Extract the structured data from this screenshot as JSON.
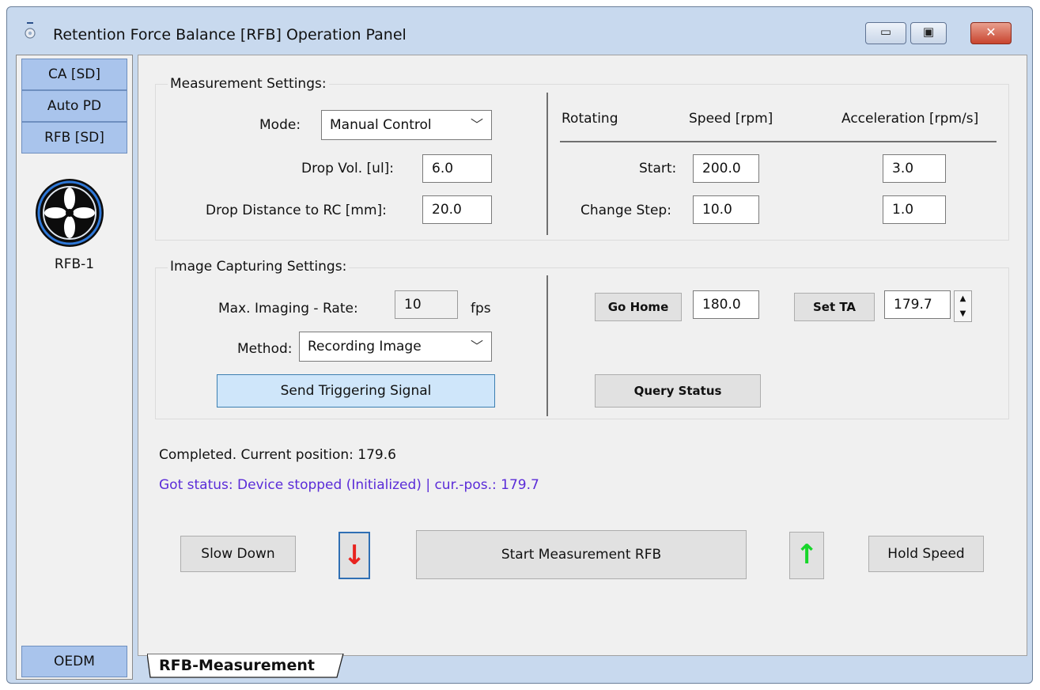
{
  "window": {
    "title": "Retention Force Balance [RFB] Operation Panel",
    "controls": {
      "minimize": "▭",
      "maximize": "▣",
      "close": "✕"
    }
  },
  "sidebar": {
    "items": [
      {
        "label": "CA [SD]"
      },
      {
        "label": "Auto PD"
      },
      {
        "label": "RFB [SD]"
      }
    ],
    "device_name": "RFB-1",
    "bottom_item": "OEDM"
  },
  "measurement_settings": {
    "title": "Measurement Settings:",
    "mode_label": "Mode:",
    "mode_value": "Manual Control",
    "drop_vol_label": "Drop Vol. [ul]:",
    "drop_vol_value": "6.0",
    "drop_distance_label": "Drop Distance to RC [mm]:",
    "drop_distance_value": "20.0"
  },
  "rotating": {
    "header_rotating": "Rotating",
    "header_speed": "Speed [rpm]",
    "header_accel": "Acceleration [rpm/s]",
    "start_label": "Start:",
    "start_speed": "200.0",
    "start_accel": "3.0",
    "step_label": "Change Step:",
    "step_speed": "10.0",
    "step_accel": "1.0"
  },
  "image_capturing": {
    "title": "Image Capturing Settings:",
    "rate_label": "Max. Imaging - Rate:",
    "rate_value": "10",
    "rate_unit": "fps",
    "method_label": "Method:",
    "method_value": "Recording Image",
    "trigger_button": "Send Triggering Signal"
  },
  "positioning": {
    "go_home_button": "Go Home",
    "go_home_value": "180.0",
    "set_ta_button": "Set TA",
    "set_ta_value": "179.7",
    "query_status_button": "Query Status"
  },
  "status": {
    "line1": "Completed. Current position: 179.6",
    "line2": "Got status: Device stopped (Initialized) | cur.-pos.: 179.7"
  },
  "controls": {
    "slow_down": "Slow Down",
    "down_arrow": "↓",
    "start_measurement": "Start Measurement  RFB",
    "up_arrow": "↑",
    "hold_speed": "Hold Speed"
  },
  "tab": {
    "label": "RFB-Measurement"
  },
  "colors": {
    "sidebar_button": "#a9c4ec",
    "status_blue": "#5a2bd8",
    "down_arrow": "#e8231f",
    "up_arrow": "#17d62a",
    "trigger_button": "#cfe6fa"
  }
}
